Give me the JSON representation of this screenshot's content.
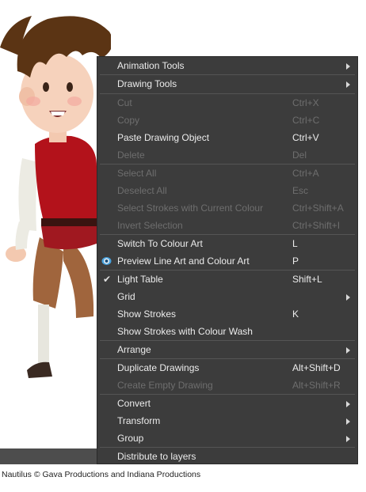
{
  "credit": "Nautilus © Gava Productions and Indiana Productions",
  "colors": {
    "menu_bg": "#3c3c3c",
    "menu_text": "#ececec",
    "menu_disabled": "#6e6e6e",
    "accent_eye": "#4aa3df"
  },
  "menu": {
    "items": [
      {
        "label": "Animation Tools",
        "shortcut": "",
        "submenu": true,
        "enabled": true
      },
      {
        "label": "Drawing Tools",
        "shortcut": "",
        "submenu": true,
        "enabled": true
      },
      {
        "label": "Cut",
        "shortcut": "Ctrl+X",
        "enabled": false
      },
      {
        "label": "Copy",
        "shortcut": "Ctrl+C",
        "enabled": false
      },
      {
        "label": "Paste Drawing Object",
        "shortcut": "Ctrl+V",
        "enabled": true
      },
      {
        "label": "Delete",
        "shortcut": "Del",
        "enabled": false
      },
      {
        "label": "Select All",
        "shortcut": "Ctrl+A",
        "enabled": false
      },
      {
        "label": "Deselect All",
        "shortcut": "Esc",
        "enabled": false
      },
      {
        "label": "Select Strokes with Current Colour",
        "shortcut": "Ctrl+Shift+A",
        "enabled": false
      },
      {
        "label": "Invert Selection",
        "shortcut": "Ctrl+Shift+I",
        "enabled": false
      },
      {
        "label": "Switch To Colour Art",
        "shortcut": "L",
        "enabled": true
      },
      {
        "label": "Preview Line Art and Colour Art",
        "shortcut": "P",
        "enabled": true,
        "icon": "eye-icon"
      },
      {
        "label": "Light Table",
        "shortcut": "Shift+L",
        "enabled": true,
        "checked": true
      },
      {
        "label": "Grid",
        "shortcut": "",
        "submenu": true,
        "enabled": true
      },
      {
        "label": "Show Strokes",
        "shortcut": "K",
        "enabled": true
      },
      {
        "label": "Show Strokes with Colour Wash",
        "shortcut": "",
        "enabled": true
      },
      {
        "label": "Arrange",
        "shortcut": "",
        "submenu": true,
        "enabled": true
      },
      {
        "label": "Duplicate Drawings",
        "shortcut": "Alt+Shift+D",
        "enabled": true
      },
      {
        "label": "Create Empty Drawing",
        "shortcut": "Alt+Shift+R",
        "enabled": false
      },
      {
        "label": "Convert",
        "shortcut": "",
        "submenu": true,
        "enabled": true
      },
      {
        "label": "Transform",
        "shortcut": "",
        "submenu": true,
        "enabled": true
      },
      {
        "label": "Group",
        "shortcut": "",
        "submenu": true,
        "enabled": true
      },
      {
        "label": "Distribute to layers",
        "shortcut": "",
        "enabled": true
      }
    ]
  }
}
